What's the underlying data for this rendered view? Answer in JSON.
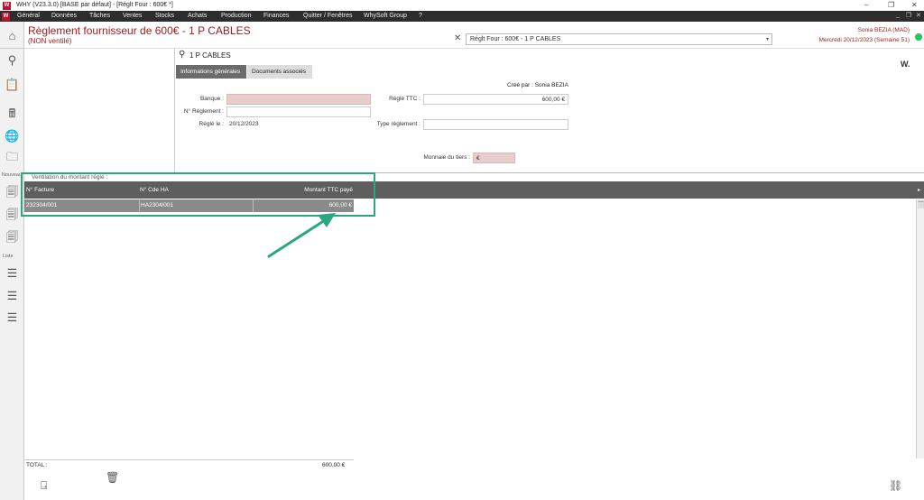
{
  "titlebar": {
    "logo": "W",
    "title": "WHY (V23.3.0)  [BASE par défaut] - [Réglt Four : 600€ *]",
    "minimize": "–",
    "restore": "❐",
    "close": "✕"
  },
  "menubar": {
    "logo": "W",
    "items": [
      "Général",
      "Données",
      "Tâches",
      "Ventes",
      "Stocks",
      "Achats",
      "Production",
      "Finances",
      "Quitter / Fenêtres",
      "WhySoft Group",
      "?"
    ],
    "wb_min": "_",
    "wb_restore": "❐",
    "wb_close": "✕"
  },
  "header": {
    "title": "Règlement fournisseur de 600€ - 1 P CABLES",
    "subtitle": "(NON ventilé)",
    "close_icon": "✕",
    "select_value": "Réglt Four : 600€ - 1 P CABLES",
    "user": "Sonia BEZIA (MAD)",
    "date": "Mercredi 20/12/2023 (Semaine 51)",
    "status_color": "#22c55e"
  },
  "sidebar": {
    "icons": {
      "home": "⌂",
      "search": "⚲",
      "clipboard": "📋",
      "calculator": "🖩",
      "globe": "🌐",
      "folder": "🗀",
      "new1": "🗐",
      "new2": "🗐",
      "new3": "🗐",
      "list1": "☰",
      "list2": "☰",
      "list3": "☰"
    },
    "nouveau_label": "Nouveau",
    "liste_label": "Liste"
  },
  "supplier": {
    "search_icon": "⚲",
    "name": "1 P CABLES"
  },
  "tabs": {
    "info": "Informations générales",
    "docs": "Documents associés"
  },
  "logo_mark": "W.",
  "form": {
    "created_by": "Créé par : Sonia BEZIA",
    "banque_label": "Banque :",
    "banque_value": "",
    "num_reglement_label": "N° Réglement :",
    "num_reglement_value": "",
    "regle_le_label": "Réglé le :",
    "regle_le_value": "20/12/2023",
    "regle_ttc_label": "Réglé TTC :",
    "regle_ttc_value": "600,00 €",
    "type_reglement_label": "Type règlement :",
    "type_reglement_value": "",
    "monnaie_label": "Monnaie du tiers :",
    "monnaie_value": "€"
  },
  "ventilation": {
    "title": "Ventilation du montant réglé :",
    "columns": [
      "N° Facture",
      "N° Cde HA",
      "Montant TTC payé"
    ],
    "rows": [
      {
        "facture": "232304/001",
        "cde": "HA2304/001",
        "montant": "600,00 €"
      }
    ],
    "total_label": "TOTAL :",
    "total_value": "600,00 €",
    "scroll_arrow": "▸"
  },
  "footer": {
    "exit_icon": "⍈",
    "trash_icon": "🗑",
    "link_icon": "⛓"
  },
  "highlight_color": "#2aa683"
}
